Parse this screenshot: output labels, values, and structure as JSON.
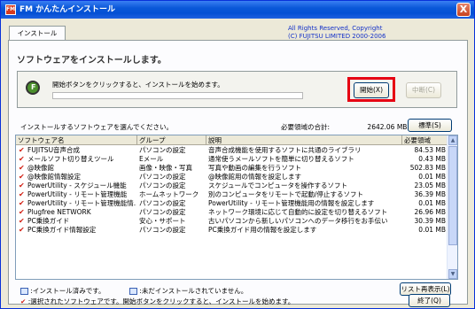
{
  "window": {
    "title": "FM かんたんインストール",
    "close_label": "X",
    "app_icon_label": "FM"
  },
  "tab": {
    "label": "インストール"
  },
  "copyright": {
    "line1": "All Rights Reserved, Copyright",
    "line2": "(C) FUJITSU LIMITED  2000-2006"
  },
  "heading": "ソフトウェアをインストールします。",
  "start": {
    "message": "開始ボタンをクリックすると、インストールを始めます。",
    "progress": 0,
    "start_button": "開始(X)",
    "stop_button": "中断(C)"
  },
  "list": {
    "label": "インストールするソフトウェアを選んでください。",
    "size_label": "必要領域の合計:",
    "size_value": "2642.06 MB",
    "standard_button": "標準(S)"
  },
  "columns": [
    "ソフトウェア名",
    "グループ",
    "説明",
    "必要領域"
  ],
  "rows": [
    {
      "name": "FUJITSU音声合成",
      "group": "パソコンの設定",
      "desc": "音声合成機能を使用するソフトに共通のライブラリ",
      "size": "84.53 MB"
    },
    {
      "name": "メールソフト切り替えツール",
      "group": "Eメール",
      "desc": "通常使うメールソフトを簡単に切り替えるソフト",
      "size": "0.43 MB"
    },
    {
      "name": "@映像館",
      "group": "画像・映像・写真",
      "desc": "写真や動画の編集を行うソフト",
      "size": "502.83 MB"
    },
    {
      "name": "@映像館情報設定",
      "group": "パソコンの設定",
      "desc": "@映像館用の情報を設定します",
      "size": "0.01 MB"
    },
    {
      "name": "PowerUtility - スケジュール機能",
      "group": "パソコンの設定",
      "desc": "スケジュールでコンピュータを操作するソフト",
      "size": "23.05 MB"
    },
    {
      "name": "PowerUtility - リモート管理機能",
      "group": "ホームネットワーク",
      "desc": "別のコンピュータをリモートで起動/停止するソフト",
      "size": "36.39 MB"
    },
    {
      "name": "PowerUtility - リモート管理機能情...",
      "group": "パソコンの設定",
      "desc": "PowerUtility - リモート管理機能用の情報を設定します",
      "size": "0.01 MB"
    },
    {
      "name": "Plugfree NETWORK",
      "group": "パソコンの設定",
      "desc": "ネットワーク環境に応じて自動的に設定を切り替えるソフト",
      "size": "26.96 MB"
    },
    {
      "name": "PC乗換ガイド",
      "group": "安心・サポート",
      "desc": "古いパソコンから新しいパソコンへのデータ移行をお手伝い",
      "size": "30.39 MB"
    },
    {
      "name": "PC乗換ガイド情報設定",
      "group": "パソコンの設定",
      "desc": "PC乗換ガイド用の情報を設定します",
      "size": "0.01 MB"
    }
  ],
  "legend": {
    "installed": ":インストール済みです。",
    "not_installed": ":未だインストールされていません。",
    "selected": ":選択されたソフトウェアです。開始ボタンをクリックすると、インストールを始めます。",
    "refresh_button": "リスト再表示(L)",
    "exit_button": "終了(Q)"
  },
  "colors": {
    "accent": "#e60012",
    "titlebar": "#0a58d8"
  }
}
